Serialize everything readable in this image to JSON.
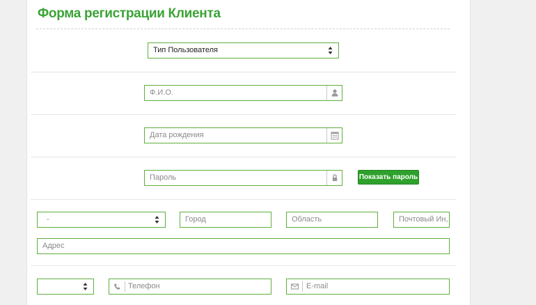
{
  "form": {
    "title": "Форма регистрации Клиента",
    "user_type_select": {
      "value": "Тип Пользователя"
    },
    "full_name": {
      "placeholder": "Ф.И.О.",
      "icon": "user-icon"
    },
    "birth_date": {
      "placeholder": "Дата рождения",
      "icon": "calendar-icon"
    },
    "password": {
      "placeholder": "Пароль",
      "icon": "lock-icon"
    },
    "show_password_button": "Показать пароль",
    "country_select": {
      "value": "-"
    },
    "city": {
      "placeholder": "Город"
    },
    "region": {
      "placeholder": "Область"
    },
    "postal_code": {
      "placeholder": "Почтовый Ин,"
    },
    "address": {
      "placeholder": "Адрес"
    },
    "phone_code_select": {
      "value": ""
    },
    "phone": {
      "placeholder": "Телефон",
      "icon": "phone-icon"
    },
    "email": {
      "placeholder": "E-mail",
      "icon": "envelope-icon"
    }
  },
  "colors": {
    "accent": "#3aa335",
    "border": "#5fae3c",
    "button": "#2ea12c"
  }
}
